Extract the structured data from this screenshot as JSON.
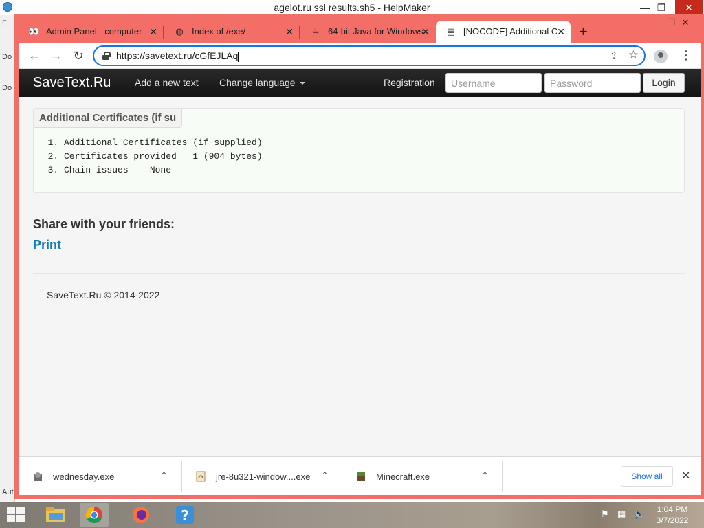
{
  "os_window": {
    "title": "agelot.ru ssl results.sh5 - HelpMaker",
    "controls": {
      "minimize": "—",
      "restore": "❐",
      "close": "✕"
    },
    "side_fragments": [
      "F",
      "Do",
      "Do",
      "Aut"
    ]
  },
  "browser": {
    "tabs": [
      {
        "label": "Admin Panel - computer",
        "icon": "eyes-icon",
        "active": false
      },
      {
        "label": "Index of /exe/",
        "icon": "globe-icon",
        "active": false
      },
      {
        "label": "64-bit Java for Windows",
        "icon": "java-icon",
        "active": false
      },
      {
        "label": "[NOCODE] Additional Ce",
        "icon": "document-icon",
        "active": true
      }
    ],
    "new_tab": "+",
    "window_controls": {
      "minimize": "—",
      "restore": "❐",
      "close": "✕"
    },
    "address": {
      "url": "https://savetext.ru/cGfEJLAq"
    }
  },
  "site": {
    "brand": "SaveText.Ru",
    "nav": {
      "add_text": "Add a new text",
      "change_language": "Change language",
      "registration": "Registration",
      "username_placeholder": "Username",
      "password_placeholder": "Password",
      "login": "Login"
    },
    "code_block": {
      "title": "Additional Certificates (if su",
      "lines": [
        "Additional Certificates (if supplied)",
        "Certificates provided   1 (904 bytes)",
        "Chain issues    None"
      ]
    },
    "share_heading": "Share with your friends:",
    "print_link": "Print",
    "footer": "SaveText.Ru © 2014-2022"
  },
  "downloads": {
    "items": [
      {
        "name": "wednesday.exe",
        "icon": "installer-icon"
      },
      {
        "name": "jre-8u321-window....exe",
        "icon": "java-installer-icon"
      },
      {
        "name": "Minecraft.exe",
        "icon": "minecraft-icon"
      }
    ],
    "show_all": "Show all",
    "close": "✕"
  },
  "taskbar": {
    "apps": [
      "file-explorer-icon",
      "chrome-icon",
      "firefox-icon",
      "help-icon"
    ],
    "clock": {
      "time": "1:04 PM",
      "date": "3/7/2022"
    }
  },
  "colors": {
    "window_frame": "#f26e66",
    "nav_bar": "#1b1b1b",
    "link": "#0d7ab8",
    "omnibox_focus": "#1a73e8"
  }
}
